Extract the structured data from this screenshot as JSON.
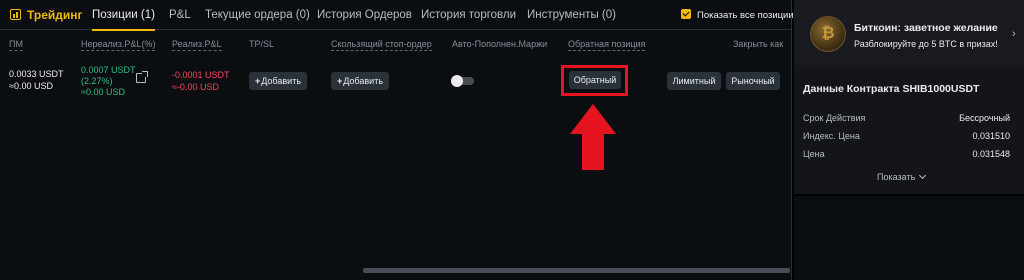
{
  "tabs": {
    "trading": "Трейдинг",
    "positions": "Позиции (1)",
    "pnl": "P&L",
    "open_orders": "Текущие ордера (0)",
    "order_history": "История Ордеров",
    "trade_history": "История торговли",
    "tools": "Инструменты (0)"
  },
  "show_all": {
    "label": "Показать все позиции",
    "checked": true
  },
  "columns": {
    "pm": "ПМ",
    "unrealized": "Нереализ.P&L(%)",
    "realized": "Реализ.P&L",
    "tpsl": "TP/SL",
    "trailing": "Скользящий стоп-ордер",
    "auto_margin": "Авто-Пополнен.Маржи",
    "reverse": "Обратная позиция",
    "close_by": "Закрыть как"
  },
  "row": {
    "pm_value": "0.0033 USDT",
    "pm_usd": "≈0.00 USD",
    "unrealized_value": "0.0007 USDT",
    "unrealized_pct": "(2.27%)",
    "unrealized_usd": "≈0.00 USD",
    "realized_value": "-0.0001 USDT",
    "realized_usd": "≈-0.00 USD",
    "tpsl_button": "Добавить",
    "trailing_button": "Добавить",
    "auto_margin_on": false,
    "reverse_button": "Обратный",
    "limit_button": "Лимитный",
    "market_button": "Рыночный"
  },
  "promo": {
    "title": "Биткоин: заветное желание",
    "subtitle": "Разблокируйте до 5 BTC в призах!",
    "logo_glyph": "₿"
  },
  "contract": {
    "title": "Данные Контракта SHIB1000USDT",
    "rows": [
      {
        "label": "Срок Действия",
        "value": "Бессрочный"
      },
      {
        "label": "Индекс. Цена",
        "value": "0.031510"
      },
      {
        "label": "Цена",
        "value": "0.031548"
      }
    ],
    "show_more": "Показать"
  },
  "colors": {
    "accent": "#f0b90b",
    "positive": "#2ebd85",
    "negative": "#f6465d",
    "highlight": "#e5141f"
  },
  "icons": {
    "trading": "chart-icon",
    "share": "share-icon",
    "chevron_right": "chevron-right-icon",
    "chevron_down": "chevron-down-icon",
    "arrow": "red-up-arrow"
  }
}
